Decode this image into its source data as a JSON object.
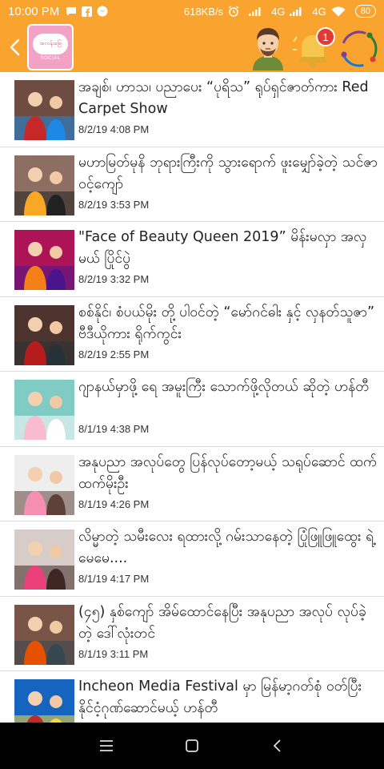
{
  "status_bar": {
    "time": "10:00 PM",
    "speed": "618KB/s",
    "network_1": "4G",
    "network_2": "4G",
    "battery": "80"
  },
  "app_bar": {
    "logo_text": "အလန်းစြေ",
    "logo_sub": "SOCIAL",
    "notification_count": "1"
  },
  "news": [
    {
      "headline": "အချစ်၊ ဟာသ၊ ပညာပေး “ပုရိသ” ရုပ်ရှင်ဇာတ်ကား Red Carpet Show",
      "date": "8/2/19 4:08 PM",
      "thumb_colors": [
        "#6d4c41",
        "#c62828",
        "#1e88e5"
      ]
    },
    {
      "headline": "မဟာမြတ်မုနိ ဘုရားကြီးကို သွားရောက် ဖူးမျှော်ခဲ့တဲ့ သင်ဇာဝင့်ကျော်",
      "date": "8/2/19 3:53 PM",
      "thumb_colors": [
        "#8d6e63",
        "#f9a825",
        "#212121"
      ]
    },
    {
      "headline": "\"Face of Beauty Queen 2019” မိန်းမလှာ အလှမယ် ပြိုင်ပွဲ",
      "date": "8/2/19 3:32 PM",
      "thumb_colors": [
        "#ad1457",
        "#f57f17",
        "#4a148c"
      ]
    },
    {
      "headline": "စစ်နိုင်၊ စံပယ်မိုး တို့ ပါဝင်တဲ့ “မော်ဂင်ဓါး နှင့် လှနတ်သူဇာ” ဗီဒီယိုကား ရိုက်ကွင်း",
      "date": "8/2/19 2:55 PM",
      "thumb_colors": [
        "#4e342e",
        "#b71c1c",
        "#263238"
      ]
    },
    {
      "headline": "ဂျာနယ်မှာဖို့ ရေ အမူးကြီး သောက်ဖို့လိုတယ် ဆိုတဲ့ ဟန်တီ",
      "date": "8/1/19 4:38 PM",
      "thumb_colors": [
        "#80cbc4",
        "#f8bbd0",
        "#ffffff"
      ]
    },
    {
      "headline": "အနုပညာ အလုပ်တွေ ပြန်လုပ်တော့မယ့် သရုပ်ဆောင် ထက်ထက်မိုးဦး",
      "date": "8/1/19 4:26 PM",
      "thumb_colors": [
        "#eeeeee",
        "#f48fb1",
        "#5d4037"
      ]
    },
    {
      "headline": "လိမ္မာတဲ့ သမီးလေး ရထားလို့ ဂမ်းသာနေတဲ့ ပြုံဖြူဖြူထွေး ရဲ့ မေမေ....",
      "date": "8/1/19 4:17 PM",
      "thumb_colors": [
        "#d7ccc8",
        "#ec407a",
        "#3e2723"
      ]
    },
    {
      "headline": "(၄၅) နှစ်ကျော် အိမ်ထောင်နေပြီး အနုပညာ အလုပ် လုပ်ခဲ့တဲ့ ဒေါ်လုံးတင်",
      "date": "8/1/19 3:11 PM",
      "thumb_colors": [
        "#795548",
        "#e65100",
        "#37474f"
      ]
    },
    {
      "headline": "Incheon Media Festival မှာ မြန်မာ့ဂတ်စုံ ဝတ်ပြီး နိုင်ငံ့ဂုဏ်ဆောင်မယ့် ဟန်တီ",
      "date": "",
      "thumb_colors": [
        "#1565c0",
        "#c62828",
        "#fdd835"
      ]
    }
  ]
}
